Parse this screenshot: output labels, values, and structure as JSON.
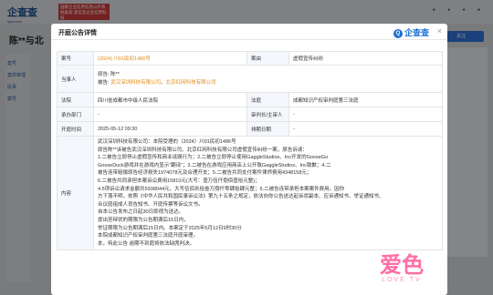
{
  "background": {
    "logo": "企查查",
    "logo_sub": "Qcc.com",
    "red_tag": "国家企业信用信息公示系统备案 查信息企业信用科技",
    "company_name": "陈**与北",
    "follow_button": "关注",
    "left_nav": [
      "案号",
      "案件审理",
      "民事",
      "案号"
    ]
  },
  "modal": {
    "title": "开庭公告详情",
    "brand": "企查查",
    "brand_icon": "Q",
    "close_icon": "×",
    "rows": {
      "case_no_label": "案号",
      "case_no": "(2024) 川01民初1486号",
      "cause_label": "案由",
      "cause": "虚假宣传纠纷",
      "party_label": "当事人",
      "plaintiff_prefix": "原告:",
      "plaintiff": "陈**",
      "defendant_prefix": "被告:",
      "defendant1": "武汉深圳科技有限公司",
      "defendant_sep": "、",
      "defendant2": "北京红网科技有限公司",
      "court_label": "法院",
      "court": "四川省成都市中级人民法院",
      "tribunal_label": "法庭",
      "tribunal": "成都知识产权审判庭第三法庭",
      "chief_label": "承办部门",
      "chief": "-",
      "judge_label": "审判长/主审人",
      "judge": "-",
      "date_label": "开庭时间",
      "date": "2025-05-12 09:30",
      "schedule_label": "排期日期",
      "schedule": "-",
      "content_label": "内容"
    },
    "content_lines": [
      "武汉深圳科技有限公司：本院受理的（2024）川01民初1486号",
      "原告陈**诉被告武汉深圳科技有限公司、北京红网科技有限公司虚假宣传纠纷一案，原告诉请：",
      "1.二被告立即停止虚假宣传和商业诋毁行为；2.二被告立即停止使用GaggleStudios、Inc开发的GooseGo",
      "GooseDuck游戏并在游戏内显示“翻译”；3.二被告在游戏应用商店上公开致GaggleStudios、Inc致歉；4.二",
      "被告连带赔偿原告经济损失1974078元及合理开支；5.二被告共同支付案件律师费用4348158元；",
      "6.二被告共同承担本案诉讼费用15810元(大写：壹万伍仟捌佰壹拾元整)；",
      "4.5项诉讼请求金额共5938044元，大写伍佰玖拾叁万捌仟零肆拾肆元整；6.二被告连带承担本案案件费用。因你",
      "方下落不明，依照《中华人民共和国民事诉讼法》第九十五条之规定，依法向你公告送达起诉状副本、应诉通知书、举证通知书、",
      "合议庭组成人员告知书、开庭传票等诉讼文书。",
      "自本公告发布之日起30日即视为送达。",
      "提出答辩状的期限为公告期满后15日内，",
      "举证期限为公告期满后15日内。本案定于2025年5月12日9时30分",
      "本院成都知识产权审判庭第三法庭开庭审理。",
      "本，特此公告 逾期不到庭将依法缺席判决。"
    ],
    "watermark_main": "爱色",
    "watermark_sub": "LOVE TV"
  }
}
